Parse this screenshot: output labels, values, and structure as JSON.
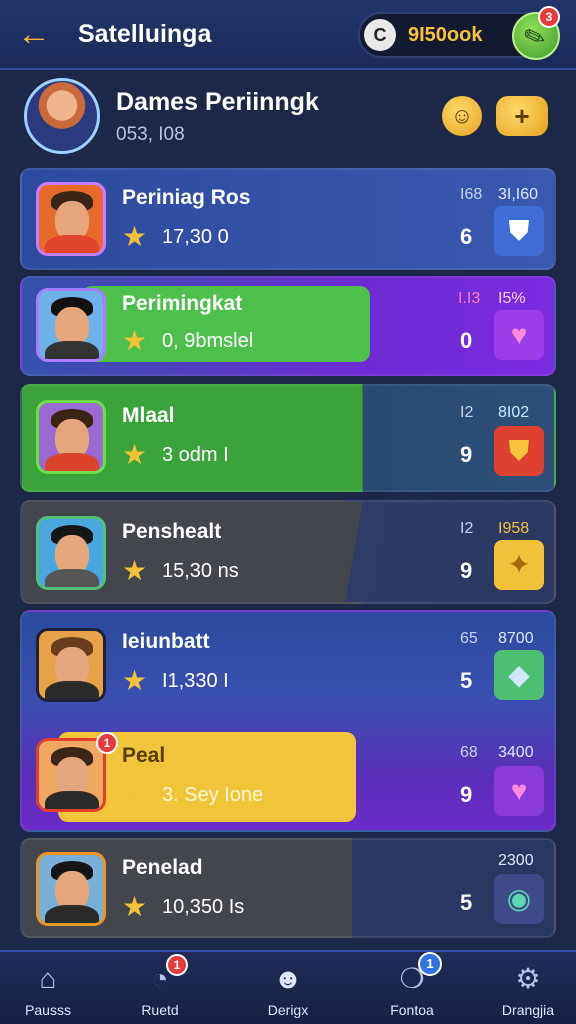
{
  "header": {
    "title": "Satelluinga",
    "coin_symbol": "C",
    "coin_value": "9I50ook",
    "notification_count": "3"
  },
  "profile": {
    "name": "Dames Periinngk",
    "sub": "053, I08",
    "smile_icon": "smile-icon",
    "plus_symbol": "+"
  },
  "cards": [
    {
      "title": "Periniag Ros",
      "stat": "17,30 0",
      "small": "I68",
      "top": "3I,I60",
      "rank": "6",
      "tile": "shield-icon"
    },
    {
      "title": "Perimingkat",
      "stat": "0, 9bmslel",
      "small": "I.I3",
      "top": "I5%",
      "rank": "0",
      "tile": "heart-icon"
    },
    {
      "title": "Mlaal",
      "stat": "3 odm I",
      "small": "I2",
      "top": "8I02",
      "rank": "9",
      "tile": "shield-icon"
    },
    {
      "title": "Penshealt",
      "stat": "15,30 ns",
      "small": "I2",
      "top": "I958",
      "rank": "9",
      "tile": "puzzle-icon"
    },
    {
      "title": "Ieiunbatt",
      "stat": "I1,330 I",
      "small": "65",
      "top": "8700",
      "rank": "5",
      "tile": "gem-icon"
    },
    {
      "title": "Peal",
      "stat": "3. Sey Ione",
      "small": "68",
      "top": "3400",
      "rank": "9",
      "tile": "heart-icon",
      "badge": "1"
    },
    {
      "title": "Penelad",
      "stat": "10,350 Is",
      "small": "",
      "top": "2300",
      "rank": "5",
      "tile": "orb-icon"
    }
  ],
  "nav": [
    {
      "label": "Pausss",
      "icon": "house-icon"
    },
    {
      "label": "Ruetd",
      "icon": "chat-icon",
      "badge": "1"
    },
    {
      "label": "Derigx",
      "icon": "face-icon"
    },
    {
      "label": "Fontoa",
      "icon": "speech-icon",
      "badge": "1"
    },
    {
      "label": "Drangjia",
      "icon": "gear-icon"
    }
  ],
  "colors": {
    "accent_gold": "#f4c23a",
    "green_highlight": "#4cc04a",
    "purple_highlight": "#7b2bd6",
    "yellow_highlight": "#f1c43a"
  }
}
